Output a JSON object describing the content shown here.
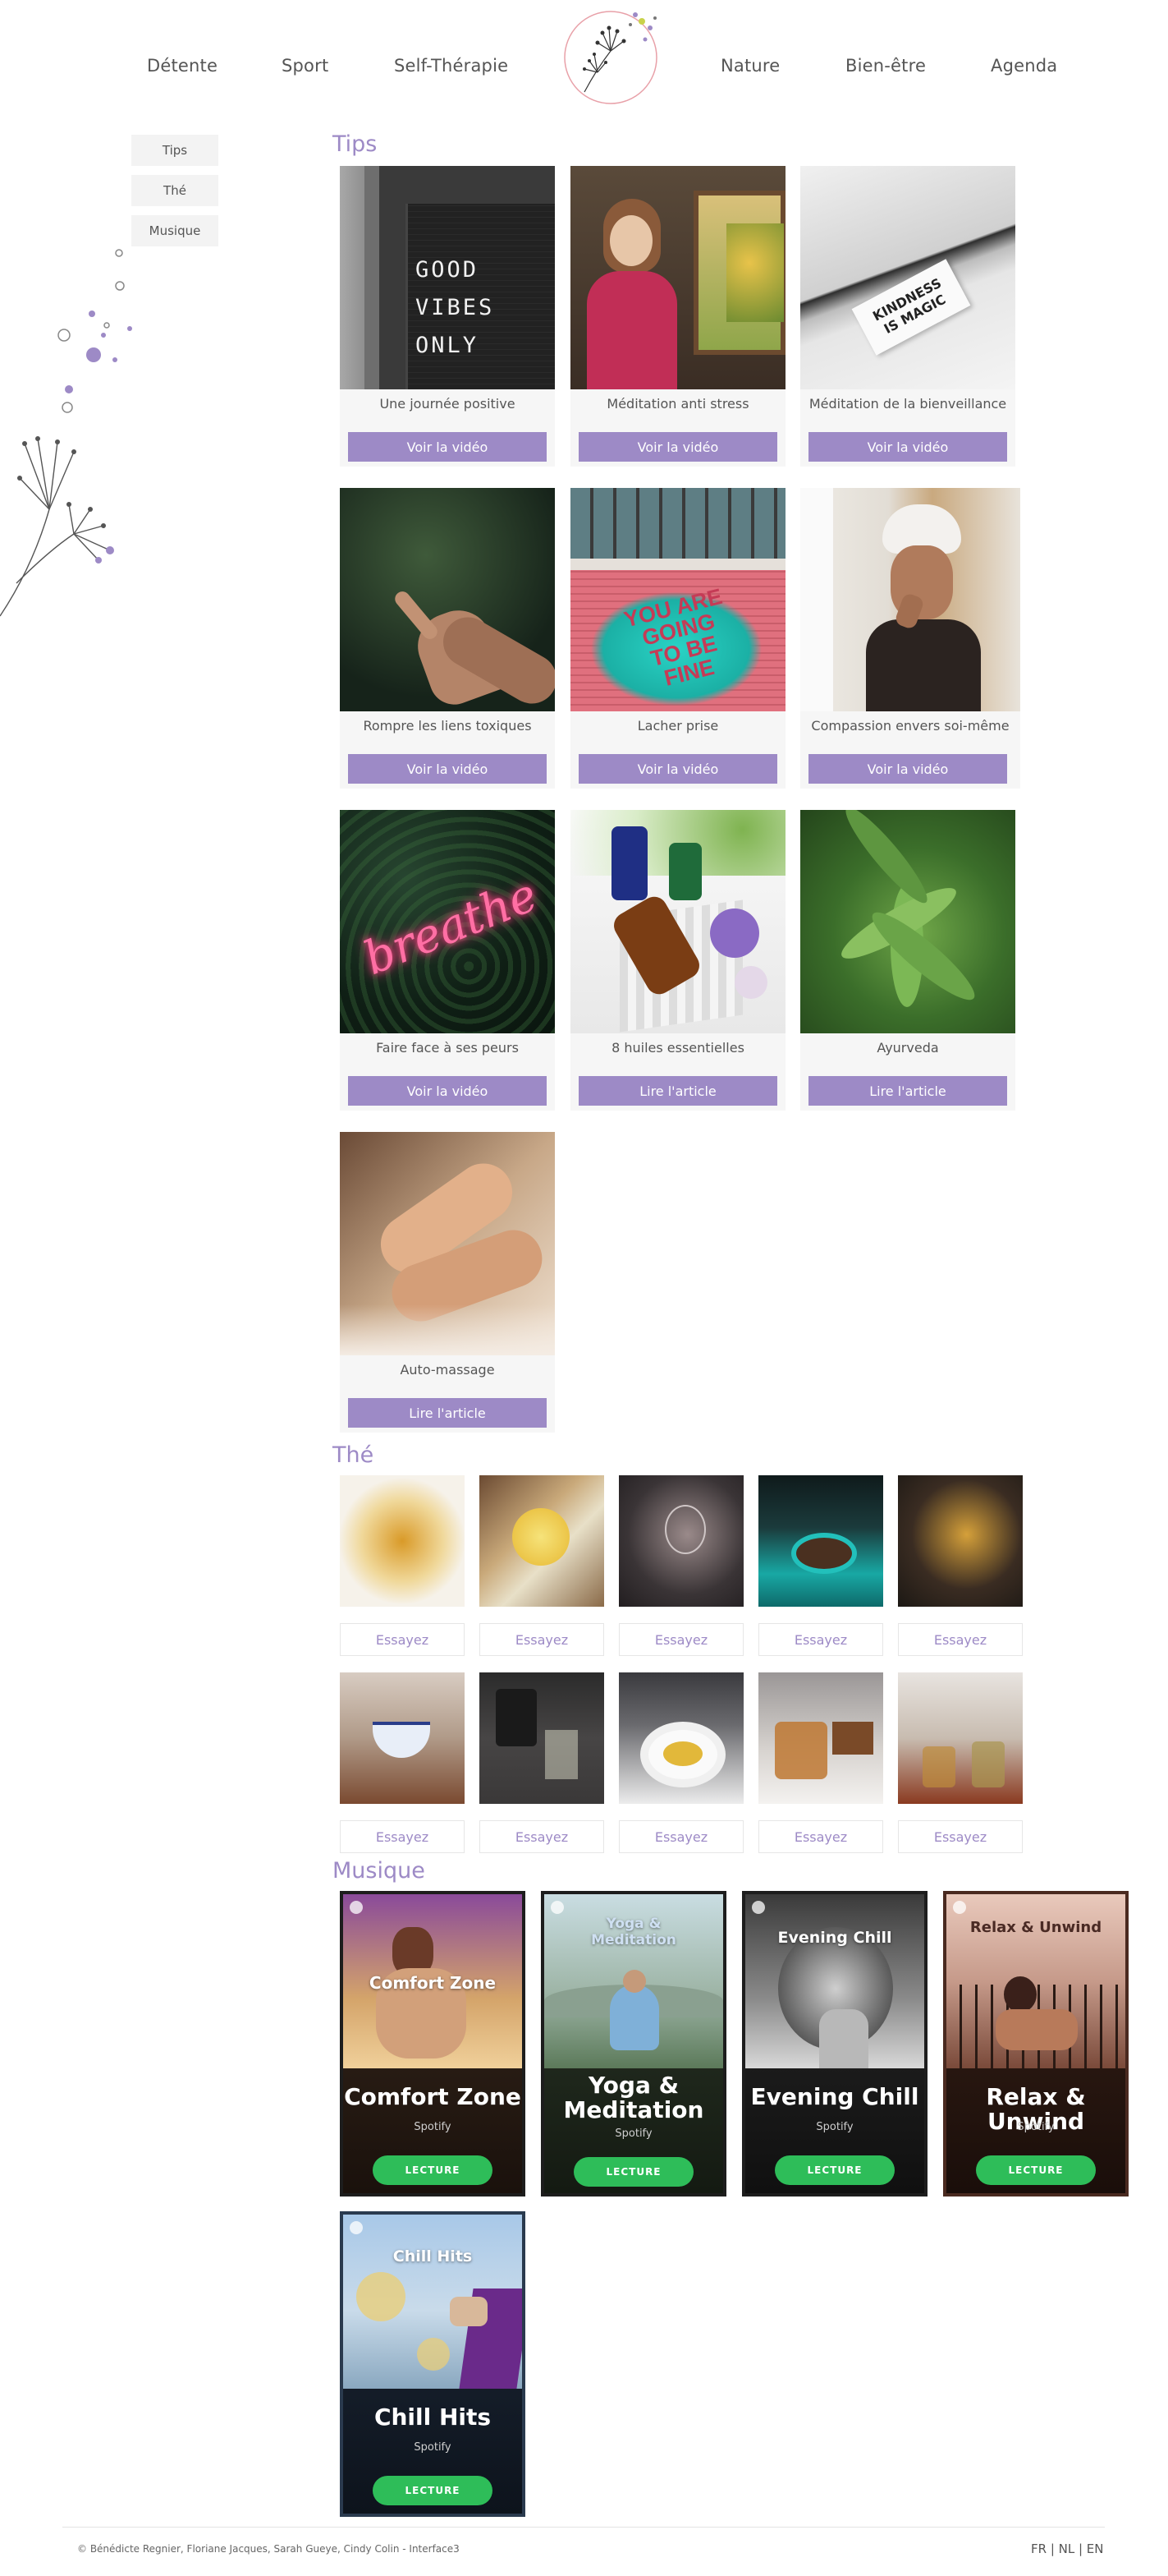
{
  "nav": {
    "items": [
      "Détente",
      "Sport",
      "Self-Thérapie",
      "Nature",
      "Bien-être",
      "Agenda"
    ]
  },
  "sidebar": {
    "items": [
      "Tips",
      "Thé",
      "Musique"
    ]
  },
  "sections": {
    "tips": "Tips",
    "the": "Thé",
    "musique": "Musique"
  },
  "tips": [
    {
      "caption": "Une journée positive",
      "button": "Voir la vidéo",
      "photo_text": [
        "GOOD",
        "VIBES",
        "ONLY"
      ]
    },
    {
      "caption": "Méditation anti stress",
      "button": "Voir la vidéo"
    },
    {
      "caption": "Méditation de la bienveillance",
      "button": "Voir la vidéo",
      "photo_text": [
        "KINDNESS",
        "IS MAGIC"
      ]
    },
    {
      "caption": "Rompre les liens toxiques",
      "button": "Voir la vidéo"
    },
    {
      "caption": "Lacher prise",
      "button": "Voir la vidéo",
      "photo_text": [
        "YOU ARE",
        "GOING",
        "TO BE",
        "FINE"
      ]
    },
    {
      "caption": "Compassion envers soi-même",
      "button": "Voir la vidéo"
    },
    {
      "caption": "Faire face à ses peurs",
      "button": "Voir la vidéo",
      "photo_text": [
        "breathe"
      ]
    },
    {
      "caption": "8 huiles essentielles",
      "button": "Lire l'article"
    },
    {
      "caption": "Ayurveda",
      "button": "Lire l'article"
    },
    {
      "caption": "Auto-massage",
      "button": "Lire l'article"
    }
  ],
  "teas": {
    "button": "Essayez",
    "count": 10
  },
  "playlists": [
    {
      "art_title": "Comfort Zone",
      "name": "Comfort Zone",
      "provider": "Spotify",
      "button": "LECTURE"
    },
    {
      "art_title": "Yoga & Meditation",
      "name": "Yoga & Meditation",
      "provider": "Spotify",
      "button": "LECTURE"
    },
    {
      "art_title": "Evening Chill",
      "name": "Evening Chill",
      "provider": "Spotify",
      "button": "LECTURE"
    },
    {
      "art_title": "Relax & Unwind",
      "name": "Relax & Unwind",
      "provider": "Spotify",
      "button": "LECTURE"
    },
    {
      "art_title": "Chill Hits",
      "name": "Chill Hits",
      "provider": "Spotify",
      "button": "LECTURE"
    }
  ],
  "footer": {
    "credits": "© Bénédicte Regnier, Floriane Jacques, Sarah Gueye, Cindy Colin - Interface3",
    "languages": "FR | NL | EN"
  },
  "colors": {
    "accent": "#9d8ac6",
    "play_green": "#2ebd59",
    "logo_ring": "#e8a0a8"
  }
}
